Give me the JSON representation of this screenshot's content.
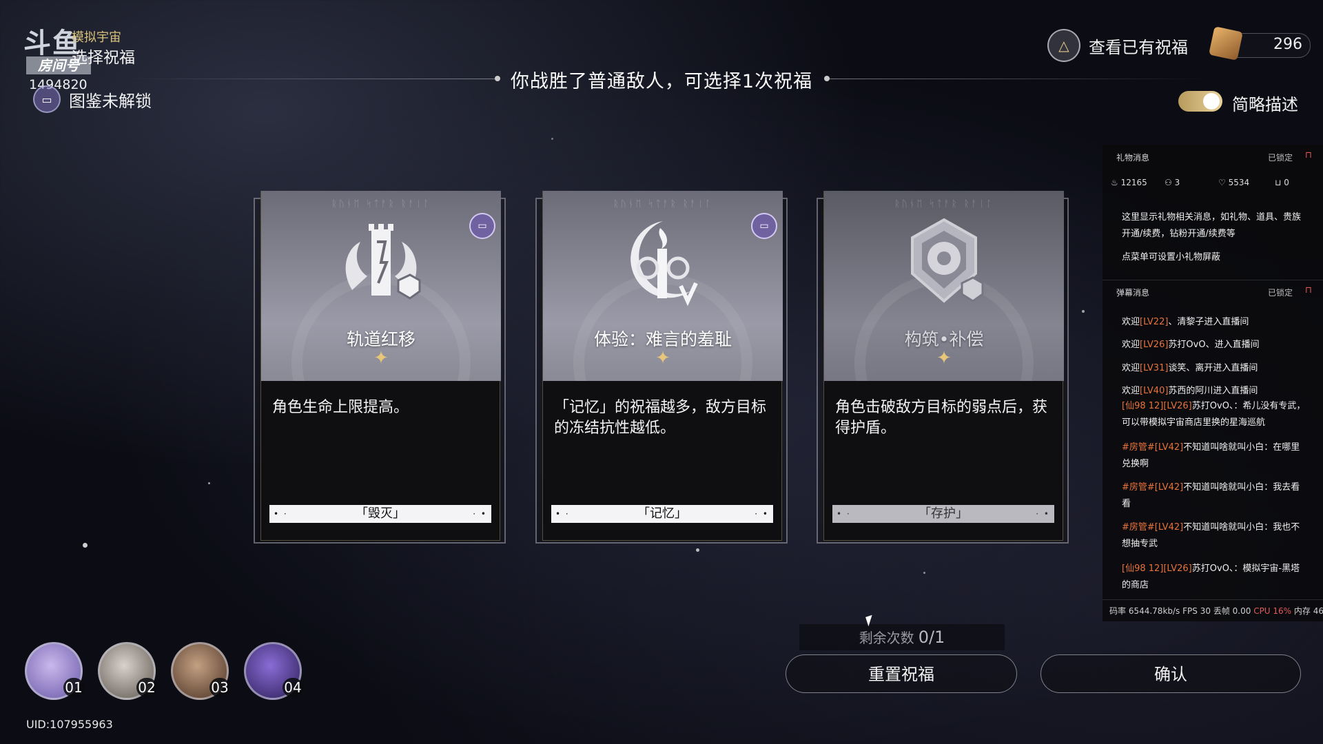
{
  "top_left": {
    "logo_text": "斗鱼",
    "room_tag": "房间号",
    "room_id": "1494820",
    "mode_label": "模拟宇宙",
    "mode_title": "选择祝福",
    "codex_text": "图鉴未解锁"
  },
  "header": {
    "title": "你战胜了普通敌人，可选择1次祝福"
  },
  "top_right": {
    "view_blessings": "查看已有祝福",
    "currency_value": "296",
    "toggle_label": "简略描述",
    "toggle_on": true
  },
  "cards": [
    {
      "name": "轨道红移",
      "star": "✦",
      "description": "角色生命上限提高。",
      "path": "「毁灭」",
      "has_codex_badge": true
    },
    {
      "name": "体验：难言的羞耻",
      "star": "✦",
      "description": "「记忆」的祝福越多，敌方目标的冻结抗性越低。",
      "path": "「记忆」",
      "has_codex_badge": true
    },
    {
      "name": "构筑•补偿",
      "star": "✦",
      "description": "角色击破敌方目标的弱点后，获得护盾。",
      "path": "「存护」",
      "has_codex_badge": false
    }
  ],
  "bottom": {
    "remaining_label": "剩余次数",
    "remaining_value": "0/1",
    "reset_button": "重置祝福",
    "confirm_button": "确认",
    "uid": "UID:107955963",
    "party": [
      "01",
      "02",
      "03",
      "04"
    ]
  },
  "live_panel": {
    "gift_title": "礼物消息",
    "gift_lock": "已锁定",
    "stats": [
      "12165",
      "3",
      "5534",
      "0"
    ],
    "gift_info": "这里显示礼物相关消息，如礼物、道具、贵族开通/续费，钻粉开通/续费等",
    "gift_hint": "点菜单可设置小礼物屏蔽",
    "danmaku_title": "弹幕消息",
    "danmaku_lock": "已锁定",
    "welcome": [
      {
        "pre": "欢迎",
        "lv": "[LV22]",
        "text": "、清黎子进入直播间"
      },
      {
        "pre": "欢迎",
        "lv": "[LV26]",
        "text": "苏打OvO、进入直播间"
      },
      {
        "pre": "欢迎",
        "lv": "[LV31]",
        "text": "谈笑、离开进入直播间"
      },
      {
        "pre": "欢迎",
        "lv": "[LV40]",
        "text": "苏西的阿川进入直播间"
      }
    ],
    "chat": [
      {
        "lv": "[仙98 12][LV26]",
        "text": "苏打OvO、：希儿没有专武，可以带模拟宇宙商店里换的星海巡航"
      },
      {
        "lv": "#房管#[LV42]",
        "text": "不知道叫啥就叫小白：在哪里兑换啊"
      },
      {
        "lv": "#房管#[LV42]",
        "text": "不知道叫啥就叫小白：我去看看"
      },
      {
        "lv": "#房管#[LV42]",
        "text": "不知道叫啥就叫小白：我也不想抽专武"
      },
      {
        "lv": "[仙98 12][LV26]",
        "text": "苏打OvO、：模拟宇宙-黑塔的商店"
      }
    ],
    "footer_rate": "码率 6544.78kb/s",
    "footer_fps": "FPS 30",
    "footer_drop": "丢帧 0.00",
    "footer_cpu": "CPU 16%",
    "footer_mem": "内存 46"
  }
}
